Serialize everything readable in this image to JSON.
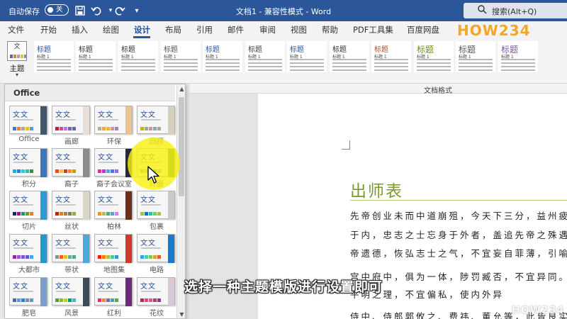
{
  "titlebar": {
    "autosave_label": "自动保存",
    "autosave_state": "关",
    "title": "文档1 - 兼容性模式 - Word",
    "search_placeholder": "搜索(Alt+Q)",
    "icons": [
      "save-icon",
      "undo-icon",
      "redo-icon",
      "search-icon"
    ]
  },
  "tabs": {
    "items": [
      "文件",
      "开始",
      "插入",
      "绘图",
      "设计",
      "布局",
      "引用",
      "邮件",
      "审阅",
      "视图",
      "帮助",
      "PDF工具集",
      "百度网盘"
    ],
    "active": "设计",
    "logo": "HOW234"
  },
  "ribbon": {
    "theme_button_label": "主题",
    "style_heading": "标题",
    "style_subheading": "标题 1",
    "group_label": "文档格式"
  },
  "gallery": {
    "section_title": "Office",
    "glyph": "文文",
    "themes": [
      {
        "name": "Office",
        "accent": "#44546a",
        "bars": [
          "#4472c4",
          "#ed7d31",
          "#a5a5a5",
          "#ffc000",
          "#5b9bd5"
        ]
      },
      {
        "name": "画廊",
        "accent": "#e8e0d8",
        "bars": [
          "#b71e42",
          "#de478e",
          "#bc72f0",
          "#795faf",
          "#586ea6"
        ]
      },
      {
        "name": "环保",
        "accent": "#e7c38f",
        "bars": [
          "#a5b592",
          "#f3a447",
          "#e7bc29",
          "#d092a7",
          "#9c85c0"
        ]
      },
      {
        "name": "回顾",
        "accent": "#d6d0c0",
        "bars": [
          "#ccb400",
          "#8fb08c",
          "#de8c9b",
          "#86a8c3",
          "#b0a68f"
        ]
      },
      {
        "name": "积分",
        "accent": "#3b76b8",
        "bars": [
          "#1cade4",
          "#2683c6",
          "#27ced7",
          "#42ba97",
          "#3e8853"
        ]
      },
      {
        "name": "裔子",
        "accent": "#8c8c8c",
        "bars": [
          "#e84c22",
          "#ffbd47",
          "#b64926",
          "#ff8427",
          "#cc9900"
        ]
      },
      {
        "name": "裔子会议室",
        "accent": "#202a3c",
        "bars": [
          "#e32d91",
          "#c830cc",
          "#4ea6dc",
          "#4775e7",
          "#8971e1"
        ]
      },
      {
        "name": "环面",
        "accent": "#4a7a2e",
        "bars": [
          "#549e39",
          "#8ab833",
          "#c0cf3a",
          "#029676",
          "#4ab5c4"
        ]
      },
      {
        "name": "切片",
        "accent": "#2b9ad8",
        "bars": [
          "#052f61",
          "#a50e82",
          "#14967c",
          "#6a9e1f",
          "#e87d37"
        ]
      },
      {
        "name": "丝状",
        "accent": "#d9d6c8",
        "bars": [
          "#a53010",
          "#de7e18",
          "#9f8351",
          "#728653",
          "#92aa4c"
        ]
      },
      {
        "name": "柏林",
        "accent": "#6d2e1e",
        "bars": [
          "#f09415",
          "#c1b56b",
          "#4baf73",
          "#5aa6c0",
          "#d17df9"
        ]
      },
      {
        "name": "包裹",
        "accent": "#c9c9c9",
        "bars": [
          "#a5c249",
          "#0f6fc6",
          "#10cf9b",
          "#7cca62",
          "#a5c249"
        ]
      },
      {
        "name": "大都市",
        "accent": "#1f9ad1",
        "bars": [
          "#92278f",
          "#9b57d3",
          "#755dd9",
          "#665eb8",
          "#45a5ed"
        ]
      },
      {
        "name": "带状",
        "accent": "#4aa9dc",
        "bars": [
          "#8e8c8c",
          "#ea6312",
          "#e6b729",
          "#6aac90",
          "#5f9c9d"
        ]
      },
      {
        "name": "地图集",
        "accent": "#d03a2c",
        "bars": [
          "#f81b02",
          "#fc7715",
          "#afbf41",
          "#50c49f",
          "#3b95c4"
        ]
      },
      {
        "name": "电路",
        "accent": "#1a7ac8",
        "bars": [
          "#2fa3ee",
          "#4bcaad",
          "#86c157",
          "#d99c3f",
          "#ce6633"
        ]
      },
      {
        "name": "肥皂",
        "accent": "#7b9fca",
        "bars": [
          "#4a66ac",
          "#629dd1",
          "#297fd5",
          "#7f8fa9",
          "#5aa2ae"
        ]
      },
      {
        "name": "风景",
        "accent": "#3f4b58",
        "bars": [
          "#549e39",
          "#8ab833",
          "#c0cf3a",
          "#029676",
          "#4ab5c4"
        ]
      },
      {
        "name": "红利",
        "accent": "#6a2c7a",
        "bars": [
          "#e03177",
          "#ef8b2f",
          "#7a6b9e",
          "#3fa3b4",
          "#6ea03c"
        ]
      },
      {
        "name": "花纹",
        "accent": "#d8c8d8",
        "bars": [
          "#ac2d63",
          "#d44d8a",
          "#c7648d",
          "#a44566",
          "#8b3b8f"
        ]
      }
    ]
  },
  "document": {
    "title": "出师表",
    "paragraph_lines": [
      "先帝创业未而中道崩殂，今天下三分，益州疲",
      "于内，忠志之士忘身于外者，盖追先帝之殊遇",
      "帝遗德，恢弘志士之气，不宜妄自菲薄，引喻",
      "宫中府中，俱为一体，陟罚臧否，不宜异同。",
      "                平明之理，不宜偏私，使内外异",
      "侍中、侍郎郭攸之、费祎、董允等，此皆良实"
    ]
  },
  "caption": "选择一种主题模版进行设置即可",
  "watermark": "HOW234",
  "colors": {
    "titlebar": "#2b579a",
    "highlight": "#f8f014",
    "doc_title": "#7a9a2e"
  }
}
